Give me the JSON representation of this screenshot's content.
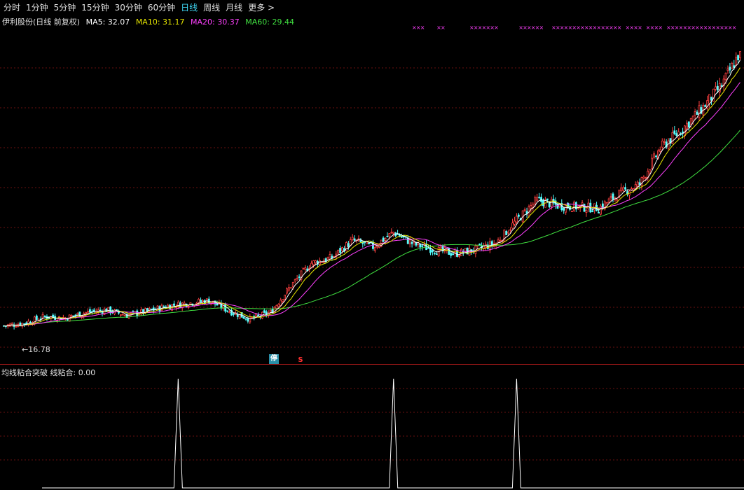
{
  "toolbar": {
    "tabs": [
      {
        "label": "分时",
        "active": false
      },
      {
        "label": "1分钟",
        "active": false
      },
      {
        "label": "5分钟",
        "active": false
      },
      {
        "label": "15分钟",
        "active": false
      },
      {
        "label": "30分钟",
        "active": false
      },
      {
        "label": "60分钟",
        "active": false
      },
      {
        "label": "日线",
        "active": true
      },
      {
        "label": "周线",
        "active": false
      },
      {
        "label": "月线",
        "active": false
      },
      {
        "label": "更多 >",
        "active": false
      }
    ]
  },
  "main_chart": {
    "title": "伊利股份(日线 前复权)",
    "ma5": "MA5: 32.07",
    "ma10": "MA10: 31.17",
    "ma20": "MA20: 30.37",
    "ma60": "MA60: 29.44",
    "low_label": "←16.78",
    "badge_ting": "停",
    "badge_s": "S",
    "marker_glyph": "×",
    "colors": {
      "up": "#ff4040",
      "down": "#54ffff",
      "ma5": "#ffffff",
      "ma10": "#e6e600",
      "ma20": "#ff40ff",
      "ma60": "#40e040",
      "grid": "#6a1010",
      "marker": "#ff40ff"
    }
  },
  "sub_chart": {
    "label": "均线粘合突破",
    "value_text": "线粘合: 0.00",
    "signal_line_color": "#ffffff"
  },
  "chart_data": {
    "type": "candlestick",
    "title": "伊利股份(日线 前复权)",
    "series": [
      {
        "name": "MA5",
        "last": 32.07
      },
      {
        "name": "MA10",
        "last": 31.17
      },
      {
        "name": "MA20",
        "last": 30.37
      },
      {
        "name": "MA60",
        "last": 29.44
      }
    ],
    "close_path": [
      [
        0,
        17.2
      ],
      [
        10,
        17.4
      ],
      [
        20,
        17.9
      ],
      [
        30,
        17.8
      ],
      [
        40,
        18.2
      ],
      [
        50,
        18.4
      ],
      [
        60,
        18.0
      ],
      [
        70,
        18.3
      ],
      [
        80,
        18.7
      ],
      [
        90,
        18.9
      ],
      [
        100,
        19.1
      ],
      [
        110,
        18.3
      ],
      [
        120,
        17.7
      ],
      [
        130,
        18.2
      ],
      [
        140,
        20.2
      ],
      [
        150,
        21.9
      ],
      [
        160,
        22.3
      ],
      [
        170,
        23.6
      ],
      [
        180,
        23.1
      ],
      [
        190,
        24.2
      ],
      [
        200,
        23.3
      ],
      [
        210,
        22.9
      ],
      [
        220,
        22.6
      ],
      [
        230,
        22.9
      ],
      [
        240,
        23.4
      ],
      [
        250,
        25.1
      ],
      [
        260,
        26.6
      ],
      [
        270,
        26.2
      ],
      [
        280,
        26.1
      ],
      [
        290,
        26.0
      ],
      [
        300,
        27.1
      ],
      [
        310,
        27.8
      ],
      [
        320,
        30.5
      ],
      [
        330,
        31.8
      ],
      [
        340,
        33.4
      ],
      [
        350,
        35.2
      ],
      [
        358,
        37.4
      ]
    ],
    "low_marker": 16.78,
    "signal_peaks": [
      85,
      190,
      250
    ]
  }
}
